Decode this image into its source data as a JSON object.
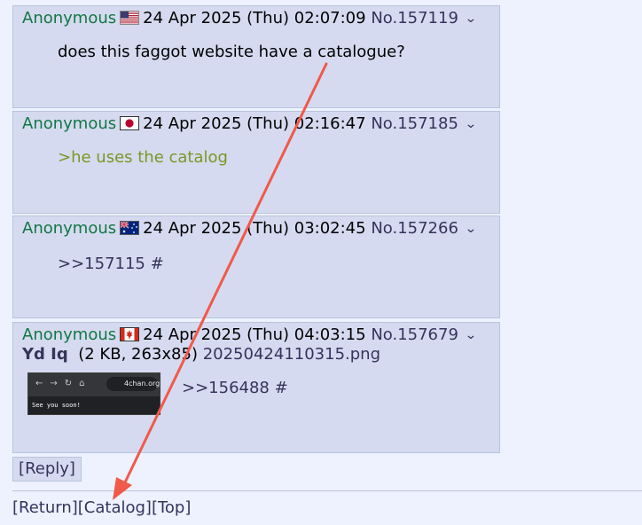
{
  "posts": [
    {
      "name": "Anonymous",
      "flag": "us-flag-icon",
      "date": "24 Apr 2025 (Thu) 02:07:09",
      "number": "No.157119",
      "comment": "does this faggot website have a catalogue?"
    },
    {
      "name": "Anonymous",
      "flag": "jp-flag-icon",
      "date": "24 Apr 2025 (Thu) 02:16:47",
      "number": "No.157185",
      "comment": ">he uses the catalog"
    },
    {
      "name": "Anonymous",
      "flag": "au-flag-icon",
      "date": "24 Apr 2025 (Thu) 03:02:45",
      "number": "No.157266",
      "comment": ">>157115 #"
    },
    {
      "name": "Anonymous",
      "flag": "ca-flag-icon",
      "date": "24 Apr 2025 (Thu) 04:03:15",
      "number": "No.157679",
      "file_prefix": "Yd Iq",
      "file_meta": "(2 KB, 263x85)",
      "file_name": "20250424110315.png",
      "thumb_url": "4chan.org",
      "thumb_text": "See you soon!",
      "comment": ">>156488 #"
    }
  ],
  "caret": "❯",
  "reply_label": "[Reply]",
  "nav": {
    "return": "[Return]",
    "catalog": "[Catalog]",
    "top": "[Top]"
  },
  "colors": {
    "annotation_arrow": "#f05a4a",
    "name": "#117743",
    "greentext": "#789922",
    "post_bg": "#d6daf0"
  }
}
